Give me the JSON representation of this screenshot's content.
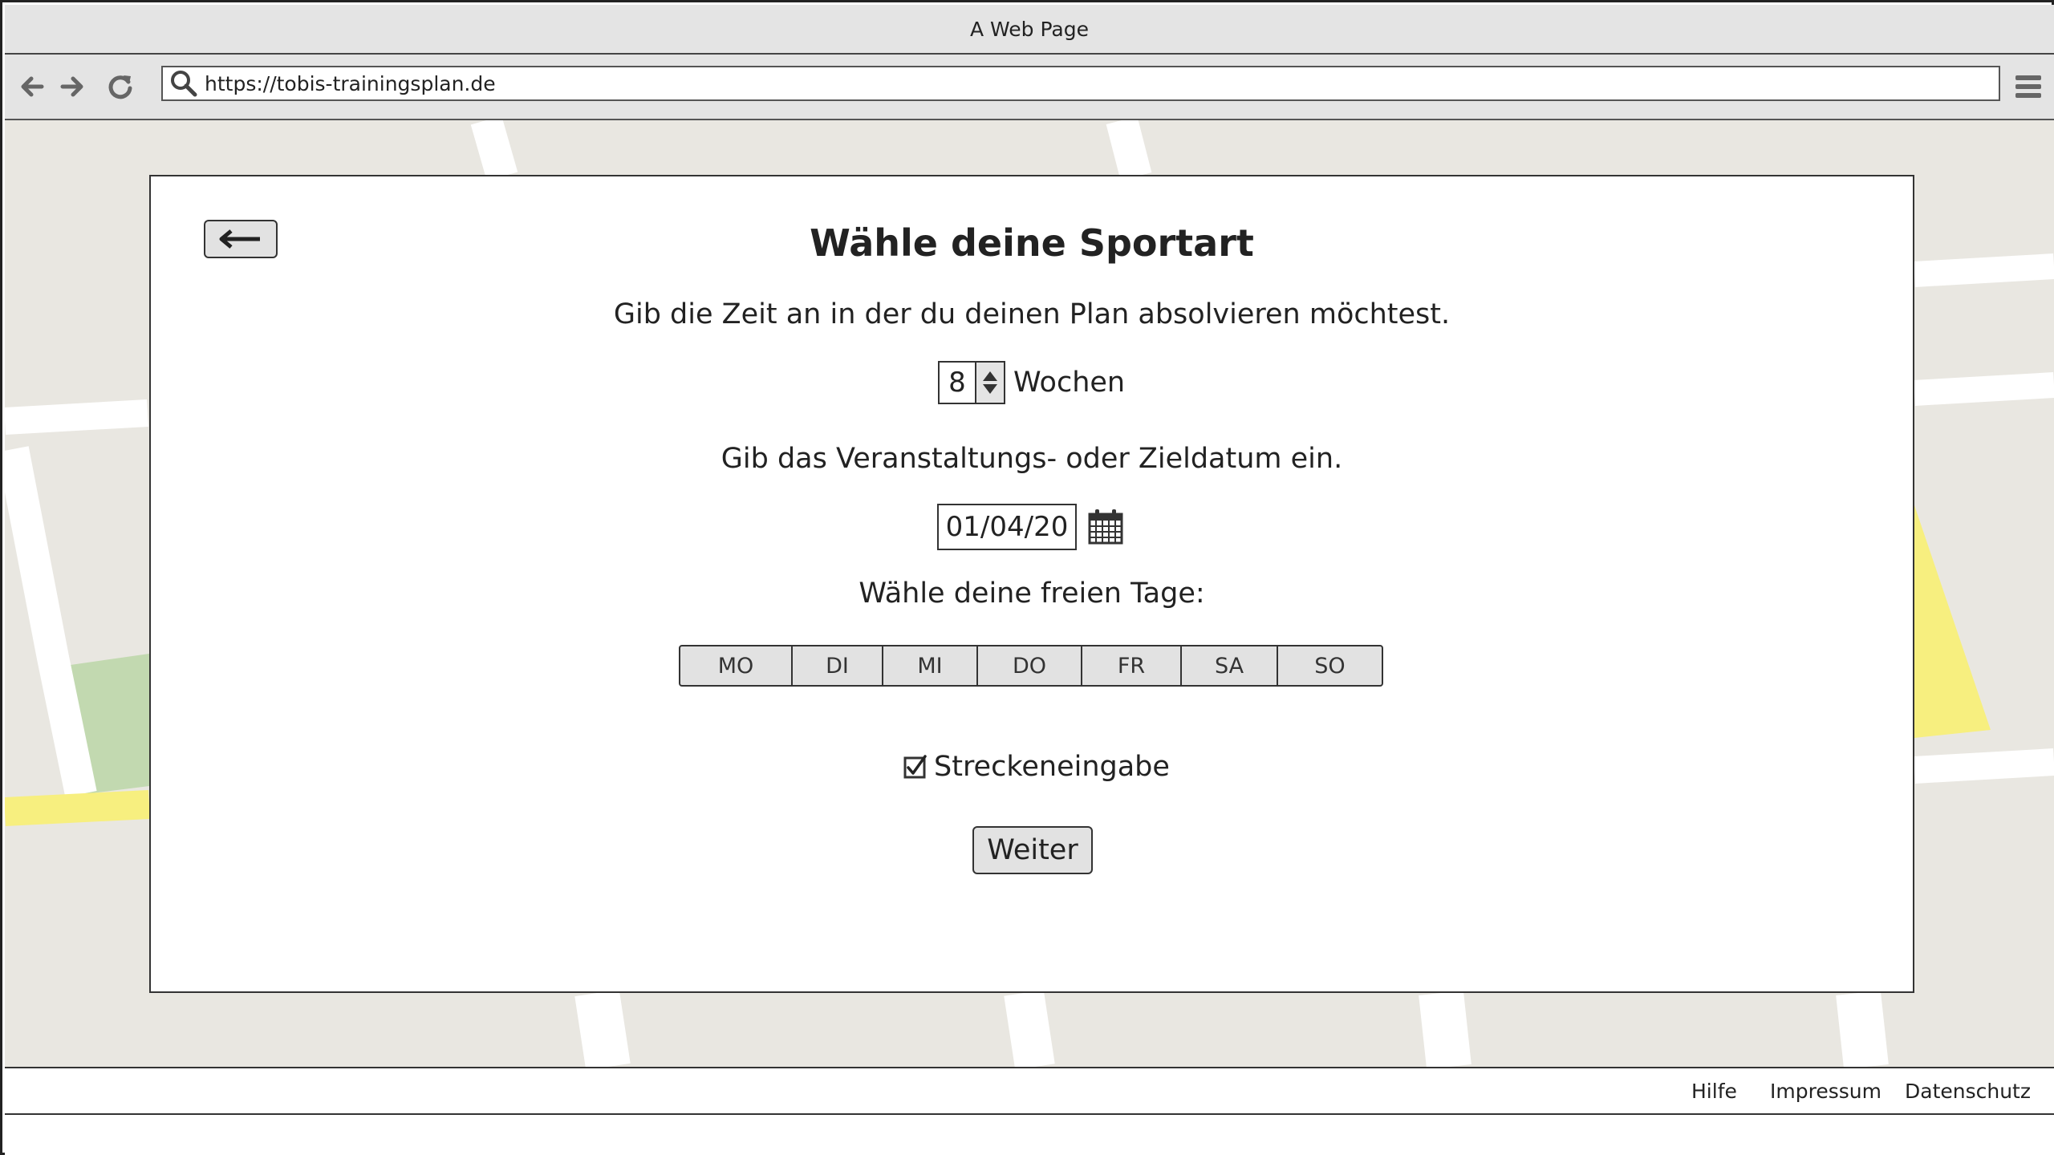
{
  "window": {
    "title": "A Web Page"
  },
  "browser": {
    "url": "https://tobis-trainingsplan.de",
    "icons": [
      "arrow-left-icon",
      "arrow-right-icon",
      "reload-icon",
      "search-icon",
      "hamburger-menu-icon"
    ]
  },
  "card": {
    "title": "Wähle deine Sportart",
    "duration_prompt": "Gib die Zeit an in der du deinen Plan absolvieren möchtest.",
    "weeks_value": "8",
    "weeks_unit": "Wochen",
    "date_prompt": "Gib das Veranstaltungs- oder Zieldatum ein.",
    "date_value": "01/04/20",
    "days_prompt": "Wähle deine freien Tage:",
    "days": [
      "MO",
      "DI",
      "MI",
      "DO",
      "FR",
      "SA",
      "SO"
    ],
    "route_checkbox_label": "Streckeneingabe",
    "route_checkbox_checked": true,
    "next_button": "Weiter"
  },
  "footer": {
    "links": [
      "Hilfe",
      "Impressum",
      "Datenschutz"
    ]
  },
  "colors": {
    "map_background": "#e9e7e1",
    "map_road": "#ffffff",
    "map_highlight": "#f7ef7f",
    "map_park": "#c2d9b0",
    "chrome": "#e4e4e4"
  }
}
